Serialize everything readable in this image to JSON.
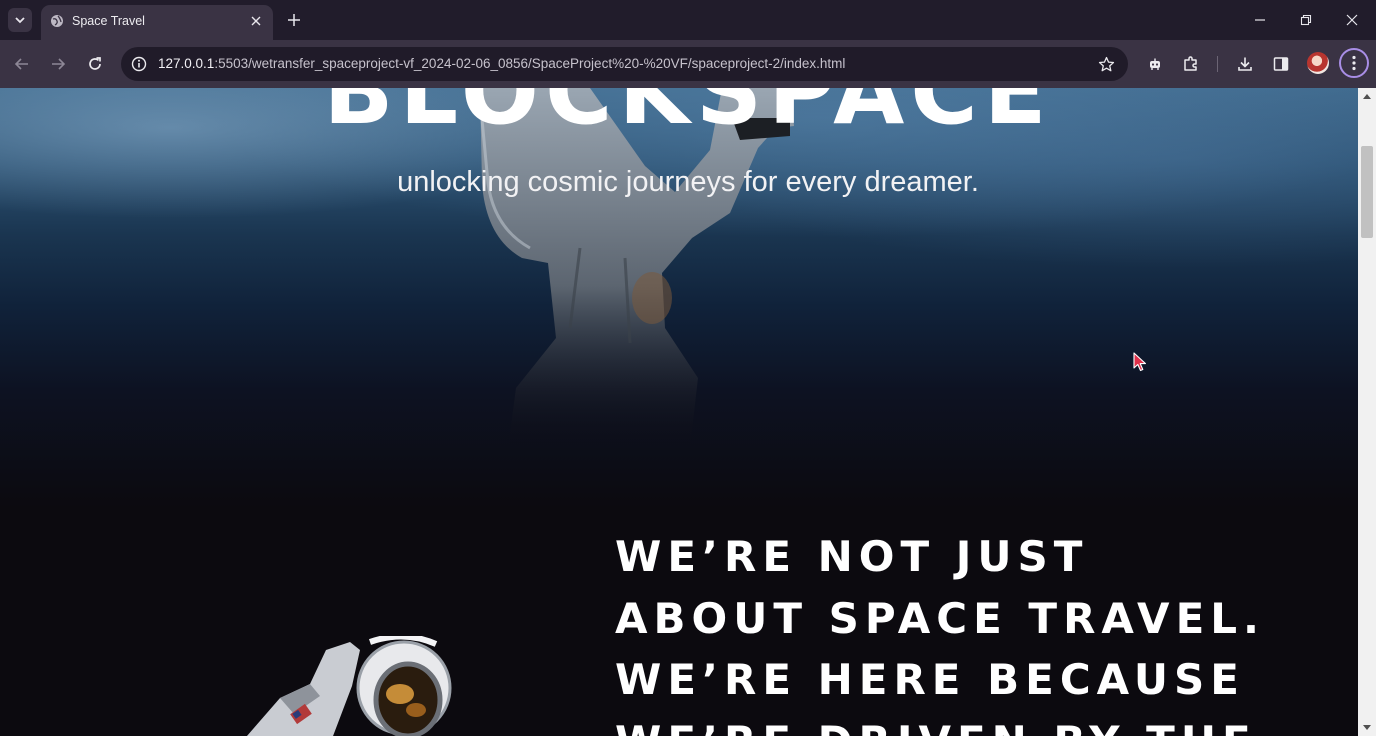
{
  "browser": {
    "tab": {
      "title": "Space Travel",
      "favicon": "globe-icon"
    },
    "address": {
      "host": "127.0.0.1",
      "path": ":5503/wetransfer_spaceproject-vf_2024-02-06_0856/SpaceProject%20-%20VF/spaceproject-2/index.html"
    },
    "icons": [
      "tab-search-icon",
      "close-icon",
      "plus-icon",
      "minimize-icon",
      "restore-icon",
      "window-close-icon",
      "back-icon",
      "forward-icon",
      "reload-icon",
      "site-info-icon",
      "star-icon",
      "extension-puzzle-icon",
      "download-icon",
      "side-panel-icon",
      "more-vertical-icon"
    ]
  },
  "page": {
    "hero": {
      "title": "BLOCKSPACE",
      "subtitle": "unlocking cosmic journeys for every dreamer."
    },
    "about": {
      "heading_lines": [
        "WE’RE NOT JUST",
        "ABOUT SPACE TRAVEL.",
        "WE’RE HERE BECAUSE",
        "WE’RE DRIVEN BY THE"
      ]
    }
  },
  "colors": {
    "tabbar_bg": "#211c2b",
    "toolbar_bg": "#3a3344",
    "page_bg": "#0c0a0f",
    "text": "#ffffff",
    "accent": "#a98ee6"
  }
}
